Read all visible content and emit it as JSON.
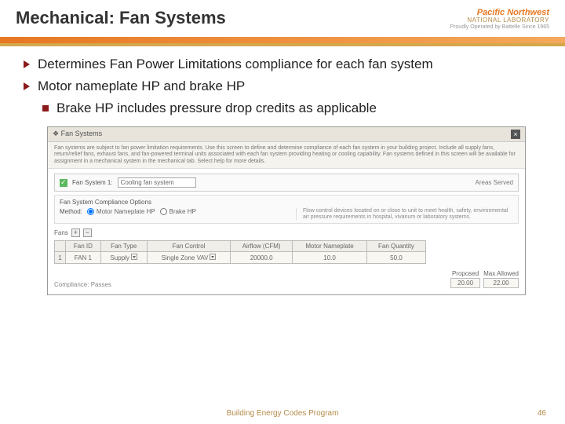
{
  "header": {
    "title": "Mechanical: Fan Systems",
    "logo": {
      "line1": "Pacific Northwest",
      "line2": "NATIONAL LABORATORY",
      "line3": "Proudly Operated by Battelle Since 1965"
    }
  },
  "bullets": {
    "b1": "Determines Fan Power Limitations compliance for each fan system",
    "b2": "Motor nameplate HP and brake HP",
    "sub1": "Brake HP includes pressure drop credits as applicable"
  },
  "shot": {
    "tabIcon": "❖",
    "tabTitle": "Fan Systems",
    "info": "Fan systems are subject to fan power limitation requirements. Use this screen to define and determine compliance of each fan system in your building project. Include all supply fans, return/relief fans, exhaust fans, and fan-powered terminal units associated with each fan system providing heating or cooling capability. Fan systems defined in this screen will be available for assignment in a mechanical system in the mechanical tab. Select help for more details.",
    "sys": {
      "label": "Fan System 1:",
      "value": "Cooling fan system",
      "areas": "Areas Served"
    },
    "optsTitle": "Fan System Compliance Options",
    "method": {
      "label": "Method:",
      "opt1": "Motor Nameplate HP",
      "opt2": "Brake HP"
    },
    "flowNote": "Flow control devices located on or close to unit to meet health, safety, environmental air pressure requirements in hospital, vivarium or laboratory systems.",
    "fansLabel": "Fans",
    "table": {
      "headers": [
        "Fan ID",
        "Fan Type",
        "Fan Control",
        "Airflow (CFM)",
        "Motor Nameplate",
        "Fan Quantity"
      ],
      "row": {
        "idx": "1",
        "id": "FAN 1",
        "type": "Supply",
        "control": "Single Zone VAV",
        "airflow": "20000.0",
        "nameplate": "10.0",
        "qty": "50.0"
      }
    },
    "compliance": {
      "status": "Compliance: Passes",
      "proposed": {
        "h": "Proposed",
        "v": "20.00"
      },
      "allowed": {
        "h": "Max Allowed",
        "v": "22.00"
      }
    }
  },
  "footer": {
    "program": "Building Energy Codes Program",
    "page": "46"
  }
}
